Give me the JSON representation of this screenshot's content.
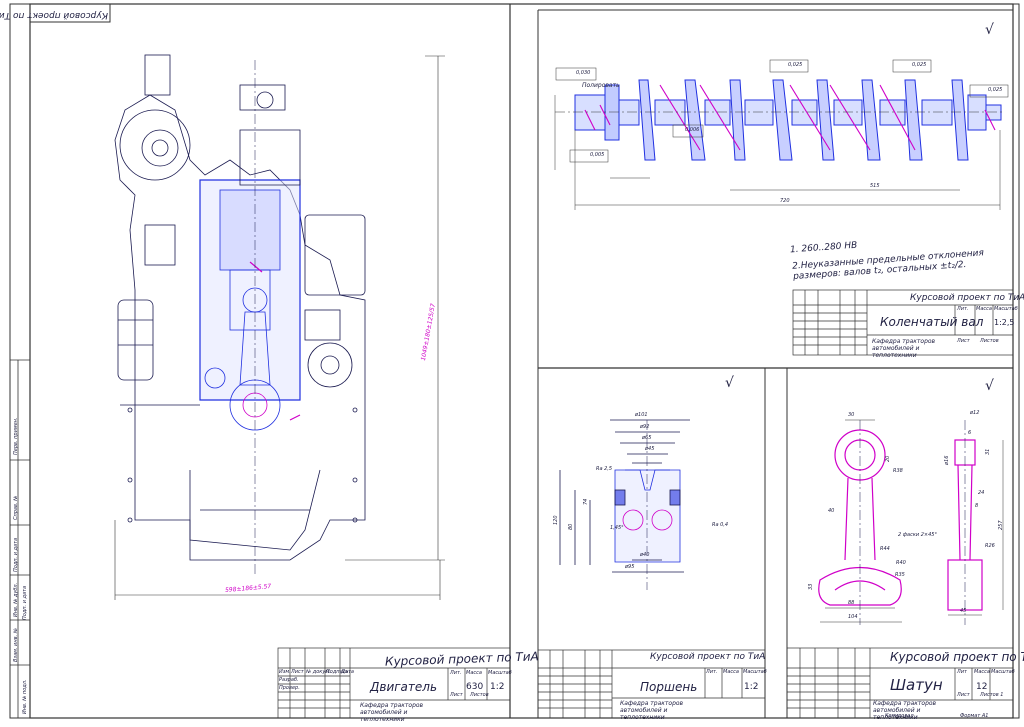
{
  "frame": {
    "top_stamp": "Курсовой проект по ТиА",
    "left_strip": [
      "Перв. примен.",
      "Справ. №",
      "Подп. и дата",
      "Инв. № дубл.",
      "Взам. инв. №",
      "Подп. и дата",
      "Инв. № подл."
    ]
  },
  "engine": {
    "dim_height": "1049±180±125/57",
    "dim_width": "598±186±5.57",
    "title_course": "Курсовой проект по ТиА",
    "title_name": "Двигатель",
    "title_dept": "Кафедра тракторов автомобилей и теплотехники",
    "mass_value": "630",
    "scale_value": "1:2",
    "col_mass": "Масса",
    "col_scale": "Масштаб",
    "col_lit": "Лит.",
    "sheet": "Лист",
    "sheets": "Листов",
    "rows": [
      "Изм.",
      "Лист",
      "№ докум.",
      "Подпись",
      "Дата",
      "Разраб.",
      "Провер."
    ]
  },
  "crankshaft": {
    "roughness": "√",
    "polishing": "Полировать",
    "tol_1": "0,030",
    "tol_2": "0,025",
    "tol_3": "0,025",
    "tol_4": "0,025",
    "tol_5": "0,006",
    "tol_6": "0,005",
    "dim_total": "720",
    "dim_mid": "515",
    "note_1": "1. 260..280 НВ",
    "note_2": "2.Неуказанные предельные отклонения",
    "note_3": "размеров: валов t₂, остальных ±t₂/2.",
    "title_course": "Курсовой проект по ТиА",
    "title_name": "Коленчатый вал",
    "title_dept": "Кафедра тракторов автомобилей и теплотехники",
    "scale_value": "1:2,5",
    "col_lit": "Лит.",
    "col_mass": "Масса",
    "col_scale": "Масштаб",
    "sheet": "Лист",
    "sheets": "Листов"
  },
  "piston": {
    "d101": "ø101",
    "d92": "ø92",
    "d65": "ø65",
    "d45": "ø45",
    "d40": "ø40",
    "d95": "ø95",
    "h120": "120",
    "h80": "80",
    "h74": "74",
    "ra25": "Ra 2,5",
    "ra04": "Ra 0,4",
    "ch": "1,45°",
    "title_course": "Курсовой проект по ТиА",
    "title_name": "Поршень",
    "title_dept": "Кафедра тракторов автомобилей и теплотехники",
    "scale_value": "1:2",
    "col_lit": "Лит.",
    "col_mass": "Масса",
    "col_scale": "Масштаб"
  },
  "conrod": {
    "d30": "30",
    "d12": "ø12",
    "r38": "R38",
    "d20": "20",
    "d40": "40",
    "d24": "24",
    "d8": "8",
    "d257": "257",
    "chamfer": "2 фаски 2×45°",
    "r44": "R44",
    "r40": "R40",
    "r35": "R35",
    "r26": "R26",
    "d33": "33",
    "d88": "88",
    "d104": "104",
    "d45": "45",
    "d16": "ø16",
    "d6": "6",
    "d31": "31",
    "title_course": "Курсовой проект по ТиА",
    "title_name": "Шатун",
    "title_dept": "Кафедра тракторов автомобилей и теплотехники",
    "mass_value": "12",
    "col_lit": "Лит",
    "col_mass": "Масса",
    "col_scale": "Масштаб",
    "sheet": "Лист",
    "sheets": "Листов 1",
    "format": "Формат А1",
    "copied": "Копировал"
  },
  "colors": {
    "ink": "#1a1a50",
    "magenta": "#d000c8",
    "blue": "#2030e0",
    "fill": "#b8c4ff"
  }
}
